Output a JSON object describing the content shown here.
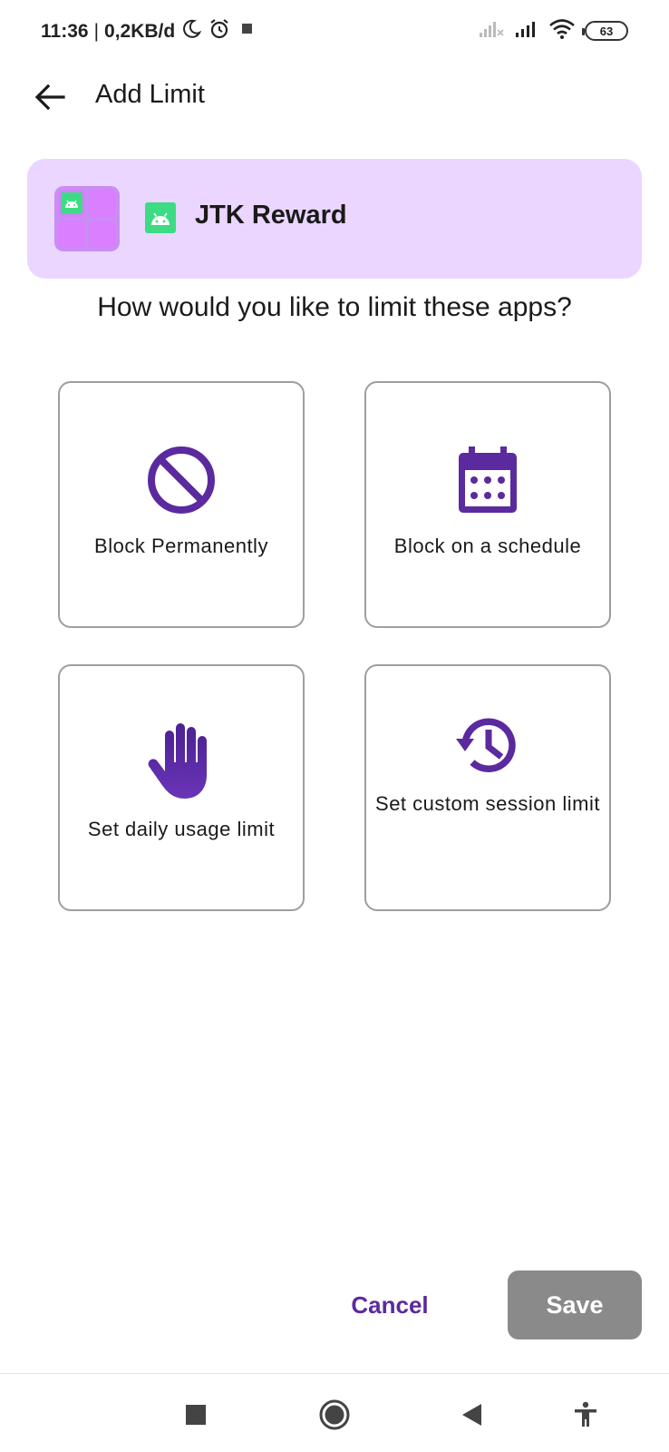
{
  "status_bar": {
    "time": "11:36",
    "separator": "|",
    "data_rate": "0,2KB/d",
    "battery_level": "63",
    "icons": [
      "moon-icon",
      "alarm-icon",
      "notification-square-icon",
      "signal-no-sim-icon",
      "signal-icon",
      "wifi-icon",
      "battery-icon"
    ]
  },
  "app_bar": {
    "title": "Add Limit",
    "back_icon": "arrow-back-icon"
  },
  "selected_app": {
    "name": "JTK Reward",
    "group_icon": "app-grid-icon",
    "app_icon": "android-icon"
  },
  "question": "How would you like to limit these apps?",
  "options": [
    {
      "label": "Block Permanently",
      "icon": "block-icon"
    },
    {
      "label": "Block on a schedule",
      "icon": "calendar-icon"
    },
    {
      "label": "Set daily usage limit",
      "icon": "hand-icon"
    },
    {
      "label": "Set custom session limit",
      "icon": "history-icon"
    }
  ],
  "actions": {
    "cancel_label": "Cancel",
    "save_label": "Save"
  },
  "nav_bar": {
    "icons": [
      "recents-square-icon",
      "home-circle-icon",
      "back-triangle-icon",
      "accessibility-icon"
    ]
  },
  "colors": {
    "accent": "#5b2a9e",
    "card_background": "#ead6ff",
    "save_disabled": "#8a8a8a",
    "android_green": "#3ddc84"
  }
}
